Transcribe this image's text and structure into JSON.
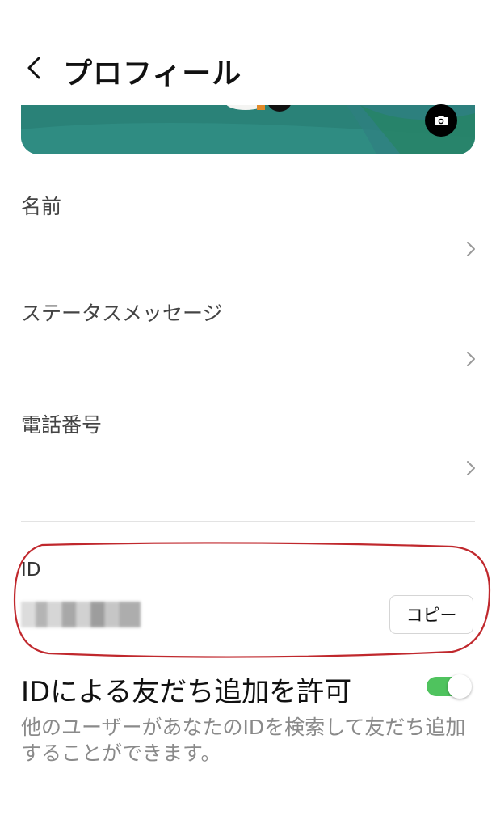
{
  "header": {
    "title": "プロフィール",
    "back_icon": "chevron-left-icon"
  },
  "cover": {
    "camera_icon": "camera-icon",
    "color": "#2d8a80"
  },
  "profile_fields": [
    {
      "label": "名前",
      "chevron_icon": "chevron-right-icon"
    },
    {
      "label": "ステータスメッセージ",
      "chevron_icon": "chevron-right-icon"
    },
    {
      "label": "電話番号",
      "chevron_icon": "chevron-right-icon"
    }
  ],
  "id_section": {
    "label": "ID",
    "copy_label": "コピー",
    "highlight_color": "#c0282d"
  },
  "id_search": {
    "title": "IDによる友だち追加を許可",
    "enabled": true,
    "toggle_color": "#4fc35e",
    "description": "他のユーザーがあなたのIDを検索して友だち追加することができます。"
  }
}
